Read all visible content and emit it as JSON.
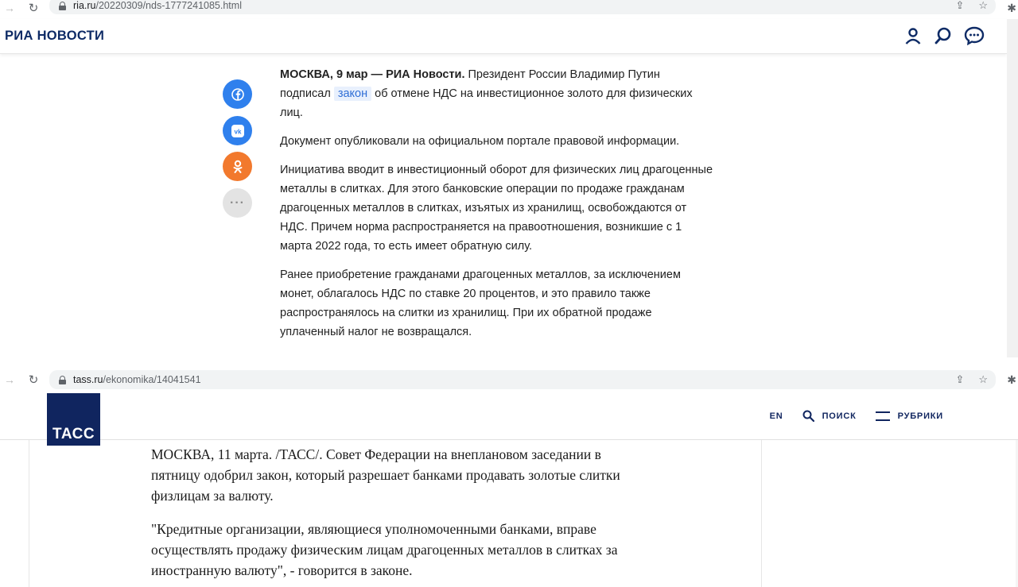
{
  "browser_top": {
    "url_host": "ria.ru",
    "url_path": "/20220309/nds-1777241085.html"
  },
  "ria": {
    "logo": "РИА НОВОСТИ",
    "share_more": "···",
    "article": {
      "lead_bold": "МОСКВА, 9 мар — РИА Новости.",
      "p1_a": " Президент России Владимир Путин подписал ",
      "p1_link": "закон",
      "p1_b": " об отмене НДС на инвестиционное золото для физических лиц.",
      "p2": "Документ опубликовали на официальном портале правовой информации.",
      "p3": "Инициатива вводит в инвестиционный оборот для физических лиц драгоценные металлы в слитках. Для этого банковские операции по продаже гражданам драгоценных металлов в слитках, изъятых из хранилищ, освобождаются от НДС. Причем норма распространяется на правоотношения, возникшие с 1 марта 2022 года, то есть имеет обратную силу.",
      "p4": "Ранее приобретение гражданами драгоценных металлов, за исключением монет, облагалось НДС по ставке 20 процентов, и это правило также распространялось на слитки из хранилищ. При их обратной продаже уплаченный налог не возвращался."
    }
  },
  "browser_bottom": {
    "url_host": "tass.ru",
    "url_path": "/ekonomika/14041541"
  },
  "tass": {
    "logo": "ТАСС",
    "nav": {
      "lang": "EN",
      "search": "ПОИСК",
      "rubrics": "РУБРИКИ"
    },
    "article": {
      "p1": "МОСКВА, 11 марта. /ТАСС/. Совет Федерации на внеплановом заседании в пятницу одобрил закон, который разрешает банками продавать золотые слитки физлицам за валюту.",
      "p2": "\"Кредитные организации, являющиеся уполномоченными банками, вправе осуществлять продажу физическим лицам драгоценных металлов в слитках за иностранную валюту\", - говорится в законе."
    }
  },
  "colors": {
    "ria_brand": "#0e2b66",
    "tass_brand": "#10255f",
    "facebook": "#2f80ed",
    "odnoklassniki": "#f2792d"
  }
}
